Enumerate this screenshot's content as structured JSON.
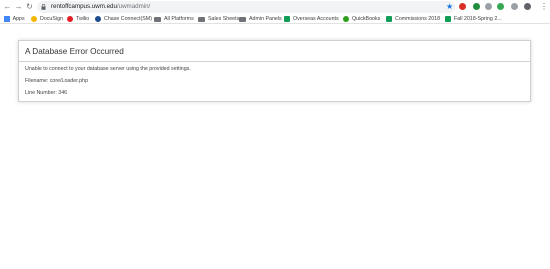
{
  "browser": {
    "url_host": "rentoffcampus.uwm.edu",
    "url_path": "/uwmadmin/",
    "nav": {
      "back_icon": "arrow-left-icon",
      "forward_icon": "arrow-right-icon",
      "reload_icon": "reload-icon"
    },
    "extension_colors": [
      "#d93025",
      "#1e8e3e",
      "#9aa0a6",
      "#34a853",
      "#9aa0a6",
      "#5f6368"
    ]
  },
  "bookmarks": [
    {
      "label": "Apps",
      "icon": "apps-grid-icon",
      "color": "#4285f4"
    },
    {
      "label": "DocuSign",
      "icon": "docusign-icon",
      "color": "#f4b400"
    },
    {
      "label": "Twilio",
      "icon": "twilio-icon",
      "color": "#e31e26"
    },
    {
      "label": "Chase Connect(SM)",
      "icon": "chase-icon",
      "color": "#1a4b8f"
    },
    {
      "label": "All Platforms",
      "icon": "folder-icon",
      "color": "#6f7378"
    },
    {
      "label": "Sales Sheets",
      "icon": "folder-icon",
      "color": "#6f7378"
    },
    {
      "label": "Admin Panels",
      "icon": "folder-icon",
      "color": "#6f7378"
    },
    {
      "label": "Overseas Accounts",
      "icon": "sheets-icon",
      "color": "#0f9d58"
    },
    {
      "label": "QuickBooks",
      "icon": "quickbooks-icon",
      "color": "#2ca01c"
    },
    {
      "label": "Commissions 2018",
      "icon": "sheets-icon",
      "color": "#0f9d58"
    },
    {
      "label": "Fall 2018-Spring 2...",
      "icon": "sheets-icon",
      "color": "#0f9d58"
    }
  ],
  "error": {
    "title": "A Database Error Occurred",
    "message": "Unable to connect to your database server using the provided settings.",
    "filename": "Filename: core/Loader.php",
    "line_number": "Line Number: 346"
  }
}
